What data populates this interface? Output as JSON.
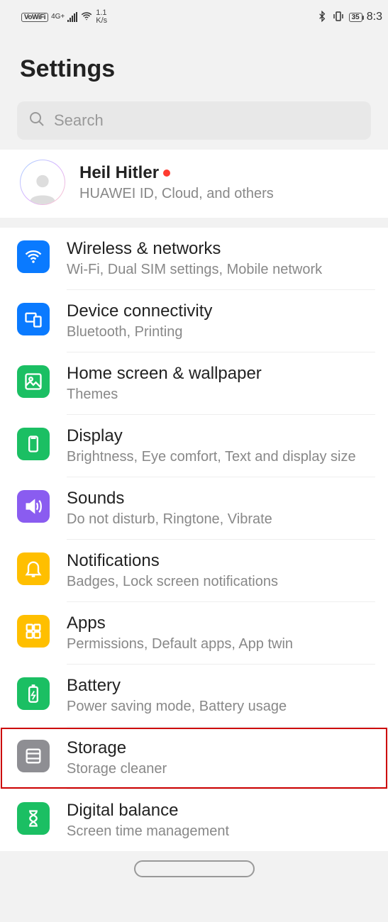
{
  "status": {
    "vowifi": "VoWiFi",
    "net_indicator": "4G+",
    "speed_top": "1.1",
    "speed_bottom": "K/s",
    "battery": "35",
    "time": "8:3"
  },
  "page_title": "Settings",
  "search": {
    "placeholder": "Search"
  },
  "account": {
    "name": "Heil Hitler",
    "sub": "HUAWEI ID, Cloud, and others"
  },
  "settings": [
    {
      "id": "wireless",
      "title": "Wireless & networks",
      "sub": "Wi-Fi, Dual SIM settings, Mobile network",
      "color": "c-blue",
      "icon": "wifi",
      "highlight": false
    },
    {
      "id": "device",
      "title": "Device connectivity",
      "sub": "Bluetooth, Printing",
      "color": "c-blue",
      "icon": "devices",
      "highlight": false
    },
    {
      "id": "home",
      "title": "Home screen & wallpaper",
      "sub": "Themes",
      "color": "c-green",
      "icon": "image",
      "highlight": false
    },
    {
      "id": "display",
      "title": "Display",
      "sub": "Brightness, Eye comfort, Text and display size",
      "color": "c-green",
      "icon": "phone",
      "highlight": false
    },
    {
      "id": "sounds",
      "title": "Sounds",
      "sub": "Do not disturb, Ringtone, Vibrate",
      "color": "c-purple",
      "icon": "sound",
      "highlight": false
    },
    {
      "id": "notif",
      "title": "Notifications",
      "sub": "Badges, Lock screen notifications",
      "color": "c-yellow",
      "icon": "bell",
      "highlight": false
    },
    {
      "id": "apps",
      "title": "Apps",
      "sub": "Permissions, Default apps, App twin",
      "color": "c-yellow",
      "icon": "grid",
      "highlight": false
    },
    {
      "id": "battery",
      "title": "Battery",
      "sub": "Power saving mode, Battery usage",
      "color": "c-green",
      "icon": "battery",
      "highlight": false
    },
    {
      "id": "storage",
      "title": "Storage",
      "sub": "Storage cleaner",
      "color": "c-grey",
      "icon": "storage",
      "highlight": true
    },
    {
      "id": "digital",
      "title": "Digital balance",
      "sub": "Screen time management",
      "color": "c-green",
      "icon": "hourglass",
      "highlight": false
    }
  ]
}
